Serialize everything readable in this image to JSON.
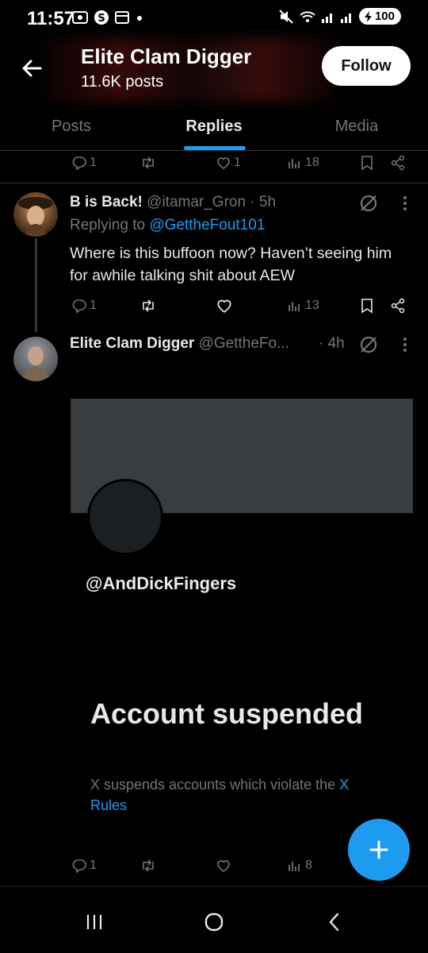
{
  "status_bar": {
    "time": "11:57",
    "battery": "100"
  },
  "header": {
    "title": "Elite Clam Digger",
    "subtitle": "11.6K posts",
    "follow_label": "Follow"
  },
  "tabs": [
    {
      "label": "Posts",
      "active": false
    },
    {
      "label": "Replies",
      "active": true
    },
    {
      "label": "Media",
      "active": false
    }
  ],
  "prev_tweet_actions": {
    "replies": "1",
    "likes": "1",
    "views": "18"
  },
  "tweet1": {
    "name": "B is Back!",
    "handle": "@itamar_Gron",
    "time": "· 5h",
    "replying_prefix": "Replying to ",
    "replying_to": "@GettheFout101",
    "text": "Where is this buffoon now? Haven’t seeing him for awhile talking shit about AEW",
    "replies": "1",
    "views": "13"
  },
  "tweet2": {
    "name": "Elite Clam Digger",
    "handle": "@GettheFo...",
    "time": "· 4h",
    "card": {
      "handle": "@AndDickFingers",
      "title": "Account suspended",
      "desc_prefix": "X suspends accounts which violate the ",
      "desc_link": "X Rules"
    },
    "replies": "1",
    "views": "8"
  },
  "colors": {
    "accent": "#1d9bf0",
    "background": "#000000",
    "secondary_text": "#71767b",
    "divider": "#2f3336"
  }
}
